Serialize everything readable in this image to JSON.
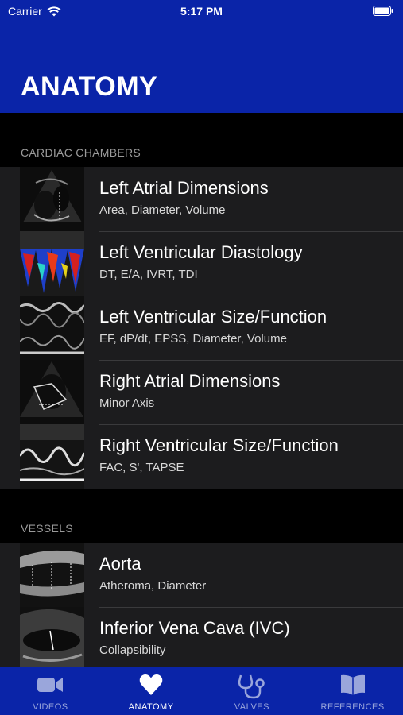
{
  "status_bar": {
    "carrier": "Carrier",
    "time": "5:17 PM"
  },
  "header": {
    "title": "ANATOMY"
  },
  "sections": [
    {
      "title": "CARDIAC CHAMBERS",
      "rows": [
        {
          "title": "Left Atrial Dimensions",
          "subtitle": "Area, Diameter, Volume"
        },
        {
          "title": "Left Ventricular Diastology",
          "subtitle": "DT, E/A, IVRT, TDI"
        },
        {
          "title": "Left Ventricular Size/Function",
          "subtitle": "EF, dP/dt, EPSS, Diameter, Volume"
        },
        {
          "title": "Right Atrial Dimensions",
          "subtitle": "Minor Axis"
        },
        {
          "title": "Right Ventricular Size/Function",
          "subtitle": "FAC, S', TAPSE"
        }
      ]
    },
    {
      "title": "VESSELS",
      "rows": [
        {
          "title": "Aorta",
          "subtitle": "Atheroma, Diameter"
        },
        {
          "title": "Inferior Vena Cava (IVC)",
          "subtitle": "Collapsibility"
        }
      ]
    }
  ],
  "tabs": [
    {
      "label": "VIDEOS",
      "icon": "video-camera-icon"
    },
    {
      "label": "ANATOMY",
      "icon": "heart-icon",
      "active": true
    },
    {
      "label": "VALVES",
      "icon": "stethoscope-icon"
    },
    {
      "label": "REFERENCES",
      "icon": "book-icon"
    }
  ],
  "colors": {
    "brand_blue": "#0a24a8",
    "row_bg": "#1c1c1e",
    "tab_inactive": "#9aa6db"
  }
}
